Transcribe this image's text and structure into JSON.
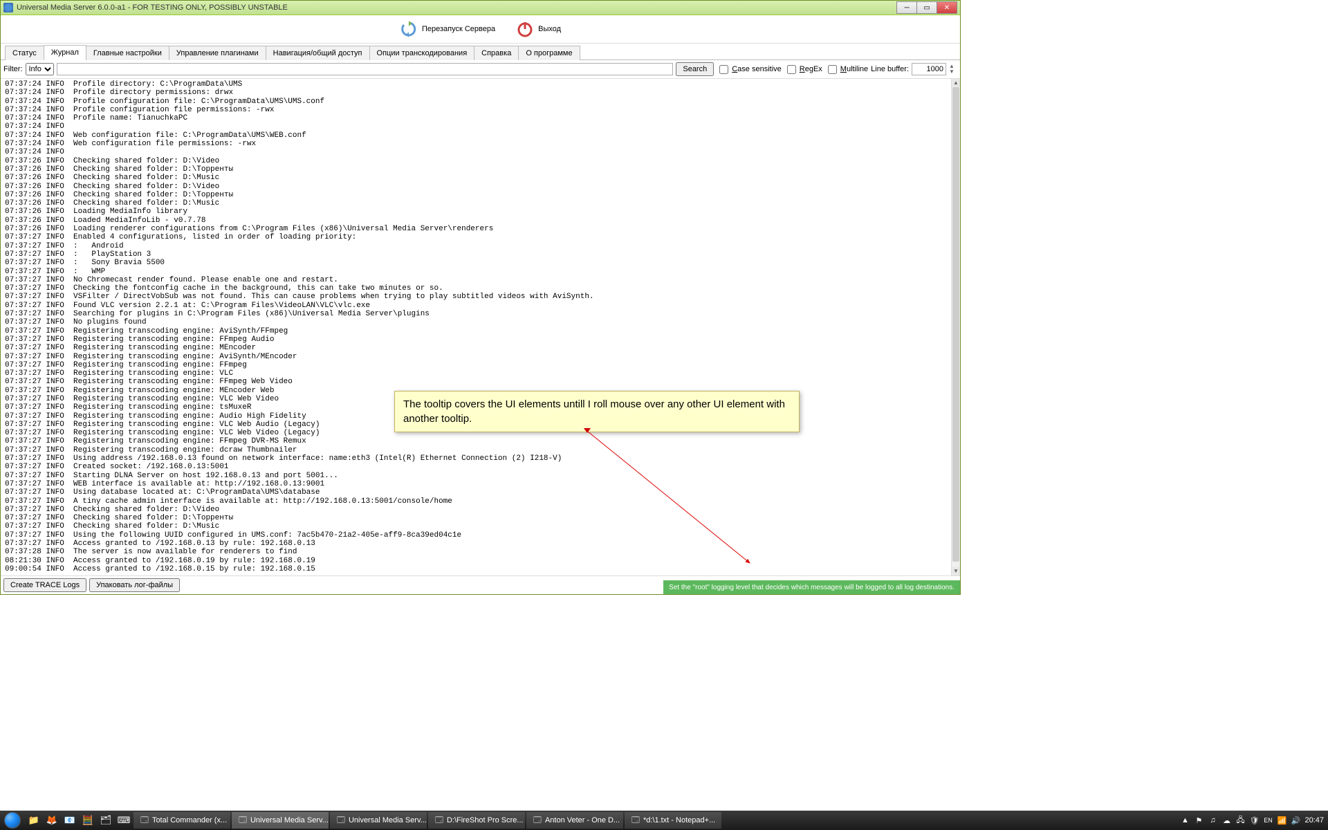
{
  "titlebar": {
    "title": "Universal Media Server 6.0.0-a1 - FOR TESTING ONLY, POSSIBLY UNSTABLE"
  },
  "toolbar": {
    "restart_label": "Перезапуск Сервера",
    "exit_label": "Выход"
  },
  "tabs": [
    "Статус",
    "Журнал",
    "Главные настройки",
    "Управление плагинами",
    "Навигация/общий доступ",
    "Опции транскодирования",
    "Справка",
    "О программе"
  ],
  "active_tab_index": 1,
  "filter": {
    "label": "Filter:",
    "level": "Info",
    "search_btn": "Search",
    "cs_label": "Case sensitive",
    "regex_label": "RegEx",
    "multiline_label": "Multiline",
    "linebuf_label": "Line buffer:",
    "linebuf_value": "1000"
  },
  "log_lines": [
    "07:37:24 INFO  Profile directory: C:\\ProgramData\\UMS",
    "07:37:24 INFO  Profile directory permissions: drwx",
    "07:37:24 INFO  Profile configuration file: C:\\ProgramData\\UMS\\UMS.conf",
    "07:37:24 INFO  Profile configuration file permissions: -rwx",
    "07:37:24 INFO  Profile name: TianuchkaPC",
    "07:37:24 INFO  ",
    "07:37:24 INFO  Web configuration file: C:\\ProgramData\\UMS\\WEB.conf",
    "07:37:24 INFO  Web configuration file permissions: -rwx",
    "07:37:24 INFO  ",
    "07:37:26 INFO  Checking shared folder: D:\\Video",
    "07:37:26 INFO  Checking shared folder: D:\\Торренты",
    "07:37:26 INFO  Checking shared folder: D:\\Music",
    "07:37:26 INFO  Checking shared folder: D:\\Video",
    "07:37:26 INFO  Checking shared folder: D:\\Торренты",
    "07:37:26 INFO  Checking shared folder: D:\\Music",
    "07:37:26 INFO  Loading MediaInfo library",
    "07:37:26 INFO  Loaded MediaInfoLib - v0.7.78",
    "07:37:26 INFO  Loading renderer configurations from C:\\Program Files (x86)\\Universal Media Server\\renderers",
    "07:37:27 INFO  Enabled 4 configurations, listed in order of loading priority:",
    "07:37:27 INFO  :   Android",
    "07:37:27 INFO  :   PlayStation 3",
    "07:37:27 INFO  :   Sony Bravia 5500",
    "07:37:27 INFO  :   WMP",
    "07:37:27 INFO  No Chromecast render found. Please enable one and restart.",
    "07:37:27 INFO  Checking the fontconfig cache in the background, this can take two minutes or so.",
    "07:37:27 INFO  VSFilter / DirectVobSub was not found. This can cause problems when trying to play subtitled videos with AviSynth.",
    "07:37:27 INFO  Found VLC version 2.2.1 at: C:\\Program Files\\VideoLAN\\VLC\\vlc.exe",
    "07:37:27 INFO  Searching for plugins in C:\\Program Files (x86)\\Universal Media Server\\plugins",
    "07:37:27 INFO  No plugins found",
    "07:37:27 INFO  Registering transcoding engine: AviSynth/FFmpeg",
    "07:37:27 INFO  Registering transcoding engine: FFmpeg Audio",
    "07:37:27 INFO  Registering transcoding engine: MEncoder",
    "07:37:27 INFO  Registering transcoding engine: AviSynth/MEncoder",
    "07:37:27 INFO  Registering transcoding engine: FFmpeg",
    "07:37:27 INFO  Registering transcoding engine: VLC",
    "07:37:27 INFO  Registering transcoding engine: FFmpeg Web Video",
    "07:37:27 INFO  Registering transcoding engine: MEncoder Web",
    "07:37:27 INFO  Registering transcoding engine: VLC Web Video",
    "07:37:27 INFO  Registering transcoding engine: tsMuxeR",
    "07:37:27 INFO  Registering transcoding engine: Audio High Fidelity",
    "07:37:27 INFO  Registering transcoding engine: VLC Web Audio (Legacy)",
    "07:37:27 INFO  Registering transcoding engine: VLC Web Video (Legacy)",
    "07:37:27 INFO  Registering transcoding engine: FFmpeg DVR-MS Remux",
    "07:37:27 INFO  Registering transcoding engine: dcraw Thumbnailer",
    "07:37:27 INFO  Using address /192.168.0.13 found on network interface: name:eth3 (Intel(R) Ethernet Connection (2) I218-V)",
    "07:37:27 INFO  Created socket: /192.168.0.13:5001",
    "07:37:27 INFO  Starting DLNA Server on host 192.168.0.13 and port 5001...",
    "07:37:27 INFO  WEB interface is available at: http://192.168.0.13:9001",
    "07:37:27 INFO  Using database located at: C:\\ProgramData\\UMS\\database",
    "07:37:27 INFO  A tiny cache admin interface is available at: http://192.168.0.13:5001/console/home",
    "07:37:27 INFO  Checking shared folder: D:\\Video",
    "07:37:27 INFO  Checking shared folder: D:\\Торренты",
    "07:37:27 INFO  Checking shared folder: D:\\Music",
    "07:37:27 INFO  Using the following UUID configured in UMS.conf: 7ac5b470-21a2-405e-aff9-8ca39ed04c1e",
    "07:37:27 INFO  Access granted to /192.168.0.13 by rule: 192.168.0.13",
    "07:37:28 INFO  The server is now available for renderers to find",
    "08:21:30 INFO  Access granted to /192.168.0.19 by rule: 192.168.0.19",
    "09:00:54 INFO  Access granted to /192.168.0.15 by rule: 192.168.0.15"
  ],
  "bottom": {
    "trace_btn": "Create TRACE Logs",
    "pack_btn": "Упаковать лог-файлы",
    "green_tooltip": "Set the \"root\" logging level that decides which messages will be logged to all log destinations."
  },
  "annotation": {
    "text": "The tooltip covers the UI elements untill I roll mouse over any other UI element with another tooltip."
  },
  "taskbar": {
    "tasks": [
      {
        "label": "Total Commander (x...",
        "active": false
      },
      {
        "label": "Universal Media Serv...",
        "active": true
      },
      {
        "label": "Universal Media Serv...",
        "active": false
      },
      {
        "label": "D:\\FireShot Pro Scre...",
        "active": false
      },
      {
        "label": "Anton Veter - One D...",
        "active": false
      },
      {
        "label": "*d:\\1.txt - Notepad+...",
        "active": false
      }
    ],
    "clock": "20:47"
  }
}
